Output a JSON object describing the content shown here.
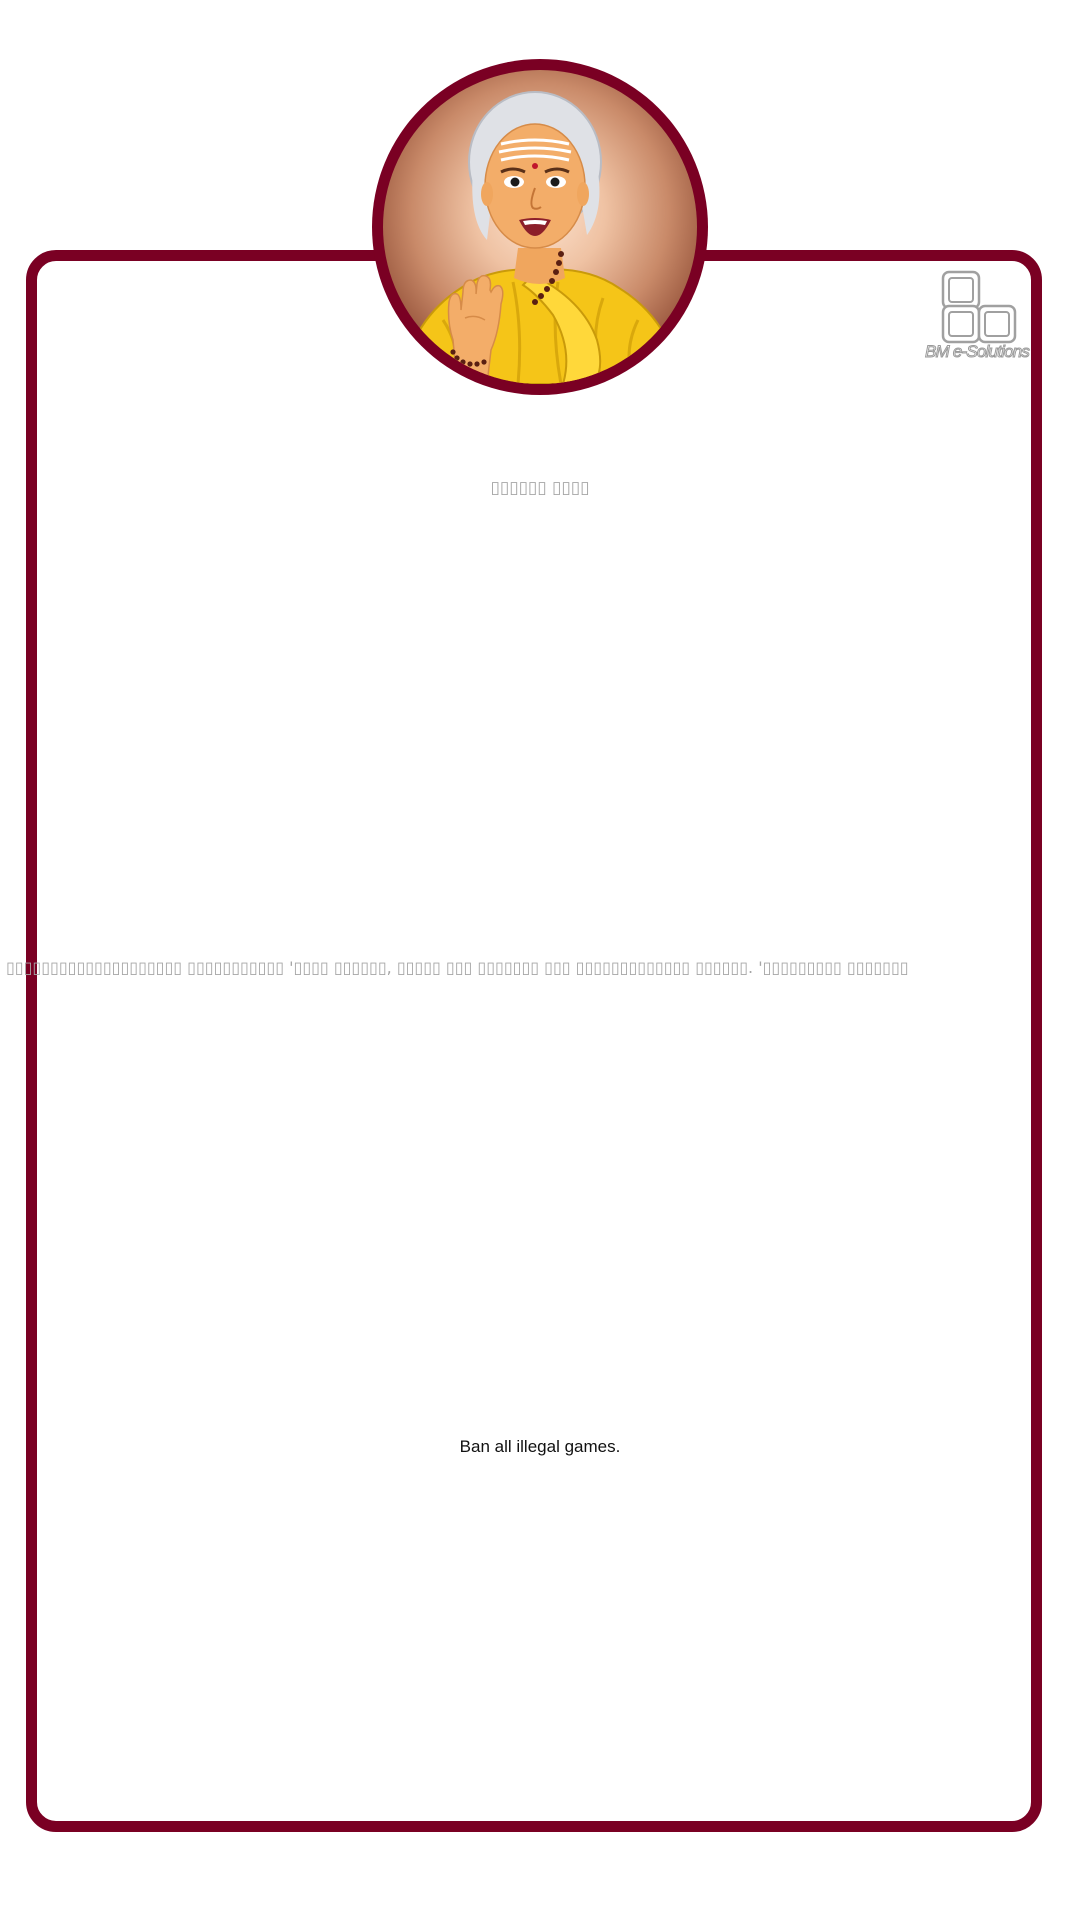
{
  "colors": {
    "frame": "#7a0023",
    "background": "#ffffff",
    "muted_text": "#a6a6a6",
    "body_text": "#111111",
    "saree": "#f5c518",
    "hair": "#e6e6ea"
  },
  "avatar": {
    "icon": "avvaiyar-portrait"
  },
  "logo": {
    "icon": "app-logo-squares",
    "text": "BM e-Solutions"
  },
  "content": {
    "title": "▯▯▯▯▯▯ ▯▯▯▯",
    "quote": "▯▯▯▯▯▯▯▯▯▯▯▯▯▯▯▯▯▯▯▯ ▯▯▯▯▯▯▯▯▯▯▯ '▯▯▯▯ ▯▯▯▯▯▯, ▯▯▯▯▯ ▯▯▯ ▯▯▯▯▯▯▯ ▯▯▯ ▯▯▯▯▯▯▯▯▯▯▯▯▯ ▯▯▯▯▯▯. '▯▯▯▯▯▯▯▯▯ ▯▯▯▯▯▯▯",
    "translation": "Ban all illegal games."
  }
}
